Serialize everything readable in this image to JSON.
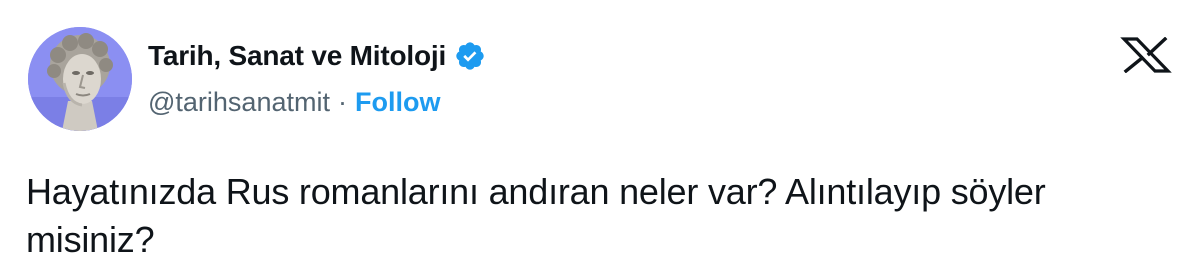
{
  "author": {
    "display_name": "Tarih, Sanat ve Mitoloji",
    "handle": "@tarihsanatmit",
    "separator": "·",
    "follow_label": "Follow",
    "verified": true,
    "avatar_icon": "david-statue-avatar"
  },
  "tweet": {
    "text": "Hayatınızda Rus romanlarını andıran neler var? Alıntılayıp söyler misiniz?"
  },
  "brand": {
    "logo_icon": "x-logo-icon"
  },
  "colors": {
    "follow": "#1d9bf0",
    "verified_badge": "#1d9bf0",
    "secondary_text": "#536471",
    "primary_text": "#0f1419",
    "avatar_bg": "#8a8ef0"
  }
}
